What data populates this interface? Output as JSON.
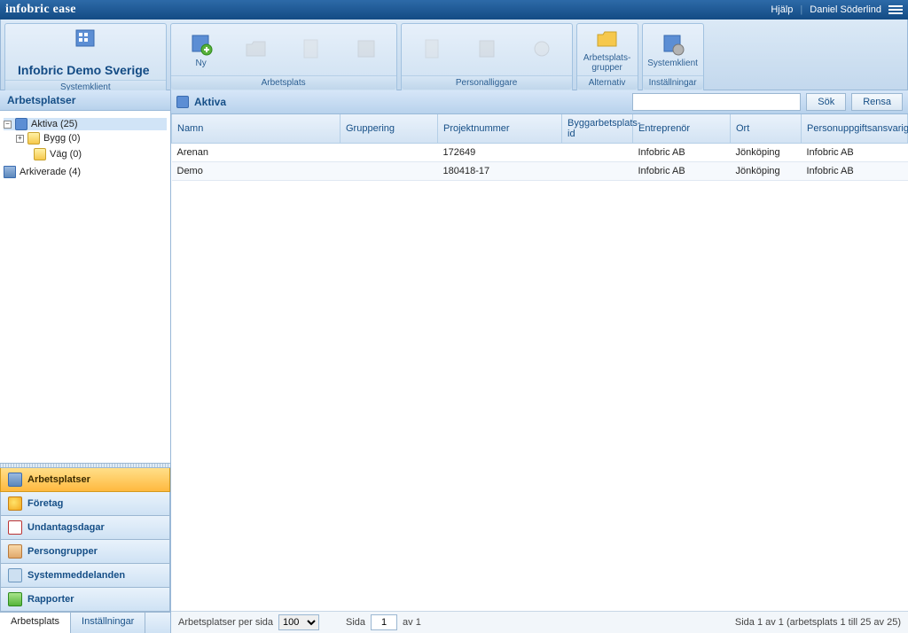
{
  "topbar": {
    "logo": "infobric ease",
    "help": "Hjälp",
    "user": "Daniel Söderlind"
  },
  "ribbon": {
    "title": "Infobric Demo Sverige",
    "group_system": "Systemklient",
    "group_arbetsplats": "Arbetsplats",
    "group_personal": "Personalliggare",
    "group_alternativ": "Alternativ",
    "group_installningar": "Inställningar",
    "ny": "Ny",
    "grupper": "Arbetsplats-\ngrupper",
    "systemklient": "Systemklient"
  },
  "sidebar": {
    "title": "Arbetsplatser",
    "tree": {
      "aktiva": "Aktiva (25)",
      "bygg": "Bygg (0)",
      "vag": "Väg (0)",
      "arkiverade": "Arkiverade (4)"
    },
    "nav": {
      "arbetsplatser": "Arbetsplatser",
      "foretag": "Företag",
      "undantag": "Undantagsdagar",
      "persongrupper": "Persongrupper",
      "systemmeddelanden": "Systemmeddelanden",
      "rapporter": "Rapporter"
    }
  },
  "content": {
    "title": "Aktiva",
    "search_placeholder": "",
    "btn_sok": "Sök",
    "btn_rensa": "Rensa",
    "columns": {
      "namn": "Namn",
      "gruppering": "Gruppering",
      "projektnummer": "Projektnummer",
      "byggid": "Byggarbetsplats-id",
      "entreprenor": "Entreprenör",
      "ort": "Ort",
      "ansvarig": "Personuppgiftsansvarig"
    },
    "rows": [
      {
        "namn": "Arenan",
        "gruppering": "",
        "pnr": "172649",
        "byggid": "",
        "entreprenor": "Infobric AB",
        "ort": "Jönköping",
        "ansvarig": "Infobric AB"
      },
      {
        "namn": "Demo",
        "gruppering": "",
        "pnr": "180418-17",
        "byggid": "",
        "entreprenor": "Infobric AB",
        "ort": "Jönköping",
        "ansvarig": "Infobric AB"
      }
    ]
  },
  "bottom": {
    "tab1": "Arbetsplats",
    "tab2": "Inställningar",
    "per_side_label": "Arbetsplatser per sida",
    "per_side_value": "100",
    "page_label_pre": "Sida",
    "page_value": "1",
    "page_label_post": "av 1",
    "status_right": "Sida 1 av 1 (arbetsplats 1 till 25 av 25)"
  }
}
